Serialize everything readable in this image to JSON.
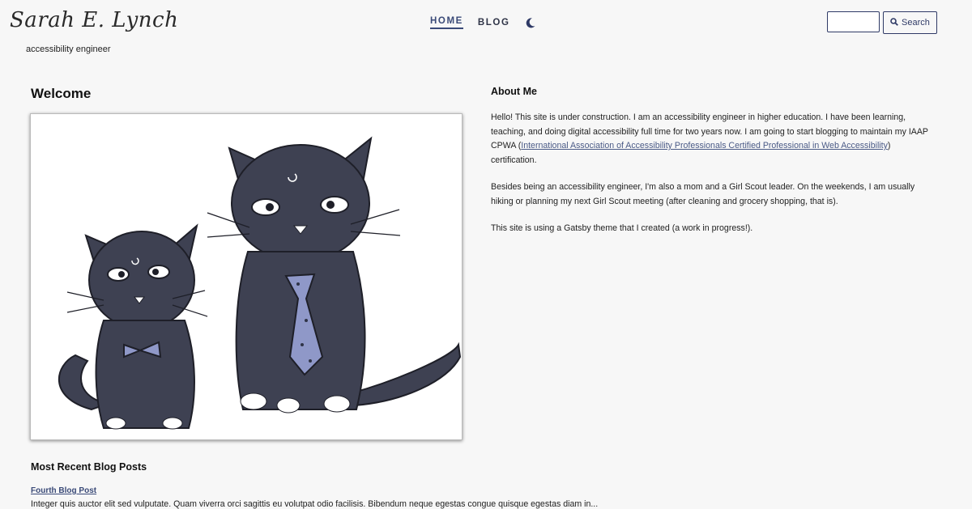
{
  "header": {
    "site_name": "Sarah E. Lynch",
    "tagline": "accessibility engineer",
    "nav": {
      "home": "HOME",
      "blog": "BLOG"
    },
    "search": {
      "placeholder": "",
      "button_label": "Search"
    }
  },
  "colors": {
    "accent": "#3a4a78",
    "cat_fur": "#3e4152",
    "tie": "#8f98c8"
  },
  "welcome": {
    "title": "Welcome"
  },
  "about": {
    "title": "About Me",
    "p1_before": "Hello! This site is under construction. I am an accessibility engineer in higher education. I have been learning, teaching, and doing digital accessibility full time for two years now. I am going to start blogging to maintain my IAAP CPWA (",
    "p1_link": "International Association of Accessibility Professionals Certified Professional in Web Accessibility",
    "p1_after": ") certification.",
    "p2": "Besides being an accessibility engineer, I'm also a mom and a Girl Scout leader. On the weekends, I am usually hiking or planning my next Girl Scout meeting (after cleaning and grocery shopping, that is).",
    "p3": "This site is using a Gatsby theme that I created (a work in progress!)."
  },
  "recent": {
    "title": "Most Recent Blog Posts",
    "post_title": "Fourth Blog Post",
    "post_excerpt": "Integer quis auctor elit sed vulputate. Quam viverra orci sagittis eu volutpat odio facilisis. Bibendum neque egestas congue quisque egestas diam in..."
  }
}
